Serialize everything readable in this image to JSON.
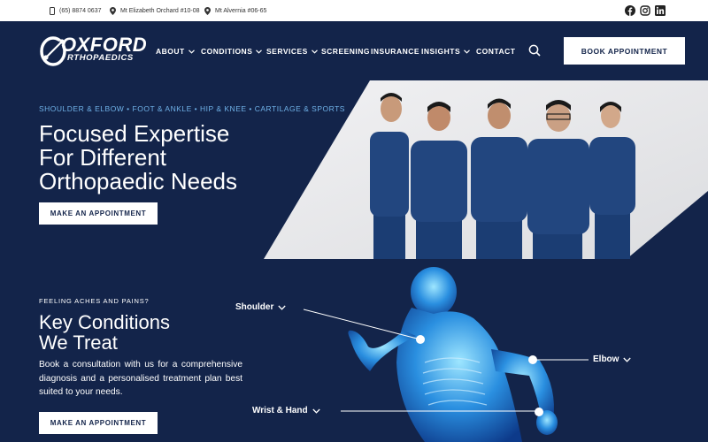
{
  "topbar": {
    "phone": "(65) 8874 0637",
    "location1": "Mt Elizabeth Orchard #10-08",
    "location2": "Mt Alvernia #06-65",
    "social": [
      "facebook-icon",
      "instagram-icon",
      "linkedin-icon"
    ]
  },
  "logo": {
    "line1": "OXFORD",
    "line2": "RTHOPAEDICS"
  },
  "nav": {
    "items": [
      {
        "label": "ABOUT"
      },
      {
        "label": "CONDITIONS"
      },
      {
        "label": "SERVICES"
      },
      {
        "label": "SCREENING"
      },
      {
        "label": "INSURANCE"
      },
      {
        "label": "INSIGHTS"
      },
      {
        "label": "CONTACT"
      }
    ],
    "book_label": "BOOK APPOINTMENT"
  },
  "hero": {
    "tags": "SHOULDER & ELBOW • FOOT & ANKLE • HIP & KNEE • CARTILAGE & SPORTS",
    "title_line1": "Focused Expertise",
    "title_line2": "For Different",
    "title_line3": "Orthopaedic Needs",
    "cta_label": "MAKE AN APPOINTMENT"
  },
  "conditions": {
    "eyebrow": "FEELING ACHES AND PAINS?",
    "title_line1": "Key Conditions",
    "title_line2": "We Treat",
    "description": "Book a consultation with us for a comprehensive diagnosis and a personalised treatment plan best suited to your needs.",
    "cta_label": "MAKE AN APPOINTMENT",
    "labels": {
      "shoulder": "Shoulder",
      "elbow": "Elbow",
      "wrist": "Wrist & Hand"
    }
  },
  "colors": {
    "navy": "#13244a",
    "accent": "#6fb1e7",
    "white": "#ffffff"
  }
}
